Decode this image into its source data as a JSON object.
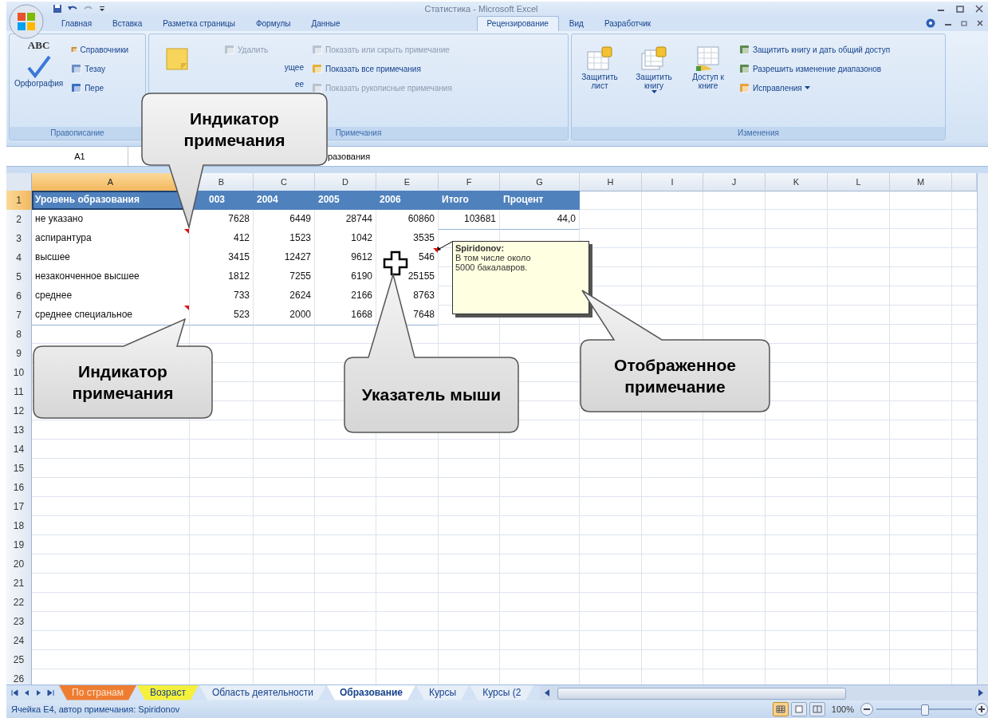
{
  "window": {
    "title": "Статистика - Microsoft Excel"
  },
  "ribbon_tabs": [
    {
      "label": "Главная",
      "selected": false
    },
    {
      "label": "Вставка",
      "selected": false
    },
    {
      "label": "Разметка страницы",
      "selected": false
    },
    {
      "label": "Формулы",
      "selected": false
    },
    {
      "label": "Данные",
      "selected": false
    },
    {
      "label": "Рецензирование",
      "selected": true
    },
    {
      "label": "Вид",
      "selected": false
    },
    {
      "label": "Разработчик",
      "selected": false
    }
  ],
  "ribbon_groups": [
    {
      "label": "Правописание",
      "columns": [
        {
          "kind": "large",
          "label": "Орфография",
          "icon_text": "ABC"
        },
        {
          "kind": "stack",
          "items": [
            {
              "label": "Справочники",
              "disabled": false,
              "covered": false
            },
            {
              "label": "Тезау",
              "disabled": false,
              "covered": false
            },
            {
              "label": "Пере",
              "disabled": false,
              "covered": false
            }
          ]
        }
      ]
    },
    {
      "label": "Примечания",
      "columns": [
        {
          "kind": "large"
        },
        {
          "kind": "stack",
          "items": [
            {
              "label": "Удалить",
              "disabled": true,
              "covered": false
            },
            {
              "label": "ущее",
              "disabled": false,
              "covered": true
            },
            {
              "label": "ее",
              "disabled": false,
              "covered": true
            }
          ]
        },
        {
          "kind": "stack",
          "items": [
            {
              "label": "Показать или скрыть примечание",
              "disabled": true,
              "covered": false
            },
            {
              "label": "Показать все примечания",
              "disabled": false,
              "covered": false
            },
            {
              "label": "Показать рукописные примечания",
              "disabled": true,
              "covered": false
            }
          ]
        }
      ]
    },
    {
      "label": "Изменения",
      "columns": [
        {
          "kind": "large",
          "label": "Защитить лист",
          "dropdown": false
        },
        {
          "kind": "large",
          "label": "Защитить книгу",
          "dropdown": true
        },
        {
          "kind": "large",
          "label": "Доступ к книге",
          "dropdown": false
        },
        {
          "kind": "stack",
          "items": [
            {
              "label": "Защитить книгу и дать общий доступ",
              "disabled": false,
              "covered": false
            },
            {
              "label": "Разрешить изменение диапазонов",
              "disabled": false,
              "covered": false
            },
            {
              "label": "Исправления",
              "disabled": false,
              "covered": false,
              "dropdown": true
            }
          ]
        }
      ]
    }
  ],
  "formula_bar": {
    "name_box": "A1",
    "formula": "разования"
  },
  "sheet": {
    "columns": [
      {
        "label": "A",
        "selected": true
      },
      {
        "label": "B",
        "selected": false
      },
      {
        "label": "C",
        "selected": false
      },
      {
        "label": "D",
        "selected": false
      },
      {
        "label": "E",
        "selected": false
      },
      {
        "label": "F",
        "selected": false
      },
      {
        "label": "G",
        "selected": false
      },
      {
        "label": "H",
        "selected": false
      },
      {
        "label": "I",
        "selected": false
      },
      {
        "label": "J",
        "selected": false
      },
      {
        "label": "K",
        "selected": false
      },
      {
        "label": "L",
        "selected": false
      },
      {
        "label": "M",
        "selected": false
      }
    ],
    "rows": [
      {
        "number": "1",
        "selected": true,
        "kind": "header",
        "cells": [
          {
            "text": "Уровень образования",
            "comment": false
          },
          {
            "text": "003",
            "comment": false
          },
          {
            "text": "2004",
            "comment": false
          },
          {
            "text": "2005",
            "comment": false
          },
          {
            "text": "2006",
            "comment": false
          },
          {
            "text": "Итого",
            "comment": false
          },
          {
            "text": "Процент",
            "comment": false
          }
        ]
      },
      {
        "number": "2",
        "selected": false,
        "kind": "data",
        "cells": [
          {
            "text": "не указано",
            "comment": false
          },
          {
            "text": "7628",
            "comment": false
          },
          {
            "text": "6449",
            "comment": false
          },
          {
            "text": "28744",
            "comment": false
          },
          {
            "text": "60860",
            "comment": false
          },
          {
            "text": "103681",
            "comment": false
          },
          {
            "text": "44,0",
            "comment": false
          }
        ]
      },
      {
        "number": "3",
        "selected": false,
        "kind": "data",
        "cells": [
          {
            "text": "аспирантура",
            "comment": true
          },
          {
            "text": "412",
            "comment": false
          },
          {
            "text": "1523",
            "comment": false
          },
          {
            "text": "1042",
            "comment": false
          },
          {
            "text": "3535",
            "comment": false
          }
        ]
      },
      {
        "number": "4",
        "selected": false,
        "kind": "data",
        "cells": [
          {
            "text": "высшее",
            "comment": false
          },
          {
            "text": "3415",
            "comment": false
          },
          {
            "text": "12427",
            "comment": false
          },
          {
            "text": "9612",
            "comment": false
          },
          {
            "text": "546",
            "comment": true
          }
        ]
      },
      {
        "number": "5",
        "selected": false,
        "kind": "data",
        "cells": [
          {
            "text": "незаконченное высшее",
            "comment": false
          },
          {
            "text": "1812",
            "comment": false
          },
          {
            "text": "7255",
            "comment": false
          },
          {
            "text": "6190",
            "comment": false
          },
          {
            "text": "25155",
            "comment": false
          }
        ]
      },
      {
        "number": "6",
        "selected": false,
        "kind": "data",
        "cells": [
          {
            "text": "среднее",
            "comment": false
          },
          {
            "text": "733",
            "comment": false
          },
          {
            "text": "2624",
            "comment": false
          },
          {
            "text": "2166",
            "comment": false
          },
          {
            "text": "8763",
            "comment": false
          }
        ]
      },
      {
        "number": "7",
        "selected": false,
        "kind": "data",
        "cells": [
          {
            "text": "среднее специальное",
            "comment": true
          },
          {
            "text": "523",
            "comment": false
          },
          {
            "text": "2000",
            "comment": false
          },
          {
            "text": "1668",
            "comment": false
          },
          {
            "text": "7648",
            "comment": false
          }
        ]
      },
      {
        "number": "8",
        "selected": false,
        "kind": "empty"
      },
      {
        "number": "9",
        "selected": false,
        "kind": "empty"
      },
      {
        "number": "10",
        "selected": false,
        "kind": "empty"
      },
      {
        "number": "11",
        "selected": false,
        "kind": "empty"
      },
      {
        "number": "12",
        "selected": false,
        "kind": "empty"
      },
      {
        "number": "13",
        "selected": false,
        "kind": "empty"
      },
      {
        "number": "14",
        "selected": false,
        "kind": "empty"
      },
      {
        "number": "15",
        "selected": false,
        "kind": "empty"
      },
      {
        "number": "16",
        "selected": false,
        "kind": "empty"
      },
      {
        "number": "17",
        "selected": false,
        "kind": "empty"
      },
      {
        "number": "18",
        "selected": false,
        "kind": "empty"
      },
      {
        "number": "19",
        "selected": false,
        "kind": "empty"
      },
      {
        "number": "20",
        "selected": false,
        "kind": "empty"
      },
      {
        "number": "21",
        "selected": false,
        "kind": "empty"
      },
      {
        "number": "22",
        "selected": false,
        "kind": "empty"
      },
      {
        "number": "23",
        "selected": false,
        "kind": "empty"
      },
      {
        "number": "24",
        "selected": false,
        "kind": "empty"
      },
      {
        "number": "25",
        "selected": false,
        "kind": "empty"
      },
      {
        "number": "26",
        "selected": false,
        "kind": "empty"
      }
    ]
  },
  "comment": {
    "author": "Spiridonov:",
    "text": "В том числе около 5000 бакалавров."
  },
  "callouts": [
    {
      "text": "Индикатор примечания"
    },
    {
      "text": "Индикатор примечания"
    },
    {
      "text": "Указатель мыши"
    },
    {
      "text": "Отображенное примечание"
    }
  ],
  "sheet_tabs": [
    {
      "label": "По странам",
      "selected": false,
      "color": "#ee7d32"
    },
    {
      "label": "Возраст",
      "selected": false,
      "color": "#f4f03c"
    },
    {
      "label": "Область деятельности",
      "selected": false
    },
    {
      "label": "Образование",
      "selected": true
    },
    {
      "label": "Курсы",
      "selected": false
    },
    {
      "label": "Курсы (2",
      "selected": false
    }
  ],
  "status_bar": {
    "text": "Ячейка E4, автор примечания: Spiridonov",
    "views": [
      {
        "selected": true
      },
      {
        "selected": false
      },
      {
        "selected": false
      }
    ],
    "zoom": {
      "label": "100%",
      "level": 0.5
    }
  }
}
